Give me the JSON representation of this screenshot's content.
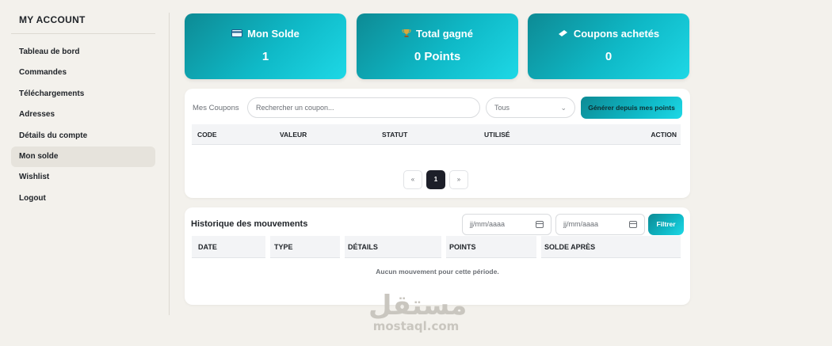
{
  "sidebar": {
    "title": "MY ACCOUNT",
    "items": [
      {
        "label": "Tableau de bord"
      },
      {
        "label": "Commandes"
      },
      {
        "label": "Téléchargements"
      },
      {
        "label": "Adresses"
      },
      {
        "label": "Détails du compte"
      },
      {
        "label": "Mon solde",
        "active": true
      },
      {
        "label": "Wishlist"
      },
      {
        "label": "Logout"
      }
    ]
  },
  "stats": [
    {
      "icon": "wallet-icon",
      "title": "Mon Solde",
      "value": "1"
    },
    {
      "icon": "trophy-icon",
      "title": "Total gagné",
      "value": "0 Points"
    },
    {
      "icon": "ticket-icon",
      "title": "Coupons achetés",
      "value": "0"
    }
  ],
  "coupons": {
    "label": "Mes Coupons",
    "search_placeholder": "Rechercher un coupon...",
    "status_selected": "Tous",
    "generate_label": "Générer depuis mes points",
    "columns": [
      "CODE",
      "VALEUR",
      "STATUT",
      "UTILISÉ",
      "ACTION"
    ],
    "pagination": {
      "prev": "«",
      "current": "1",
      "next": "»"
    }
  },
  "history": {
    "title": "Historique des mouvements",
    "date_from_placeholder": "jj/mm/aaaa",
    "date_to_placeholder": "jj/mm/aaaa",
    "filter_label": "Filtrer",
    "columns": [
      "DATE",
      "TYPE",
      "DÉTAILS",
      "POINTS",
      "SOLDE APRÈS"
    ],
    "empty_message": "Aucun mouvement pour cette période."
  },
  "watermark": {
    "logo": "مستقل",
    "text": "mostaql.com"
  },
  "colors": {
    "accent_start": "#0d8a94",
    "accent_end": "#1ed8e6",
    "page_bg": "#f3f1ec",
    "active_page": "#1d1f29"
  }
}
